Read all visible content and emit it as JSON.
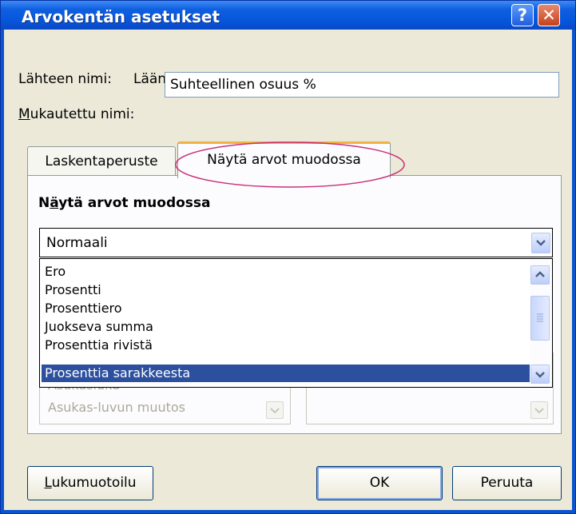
{
  "window": {
    "title": "Arvokentän asetukset",
    "help_label": "?",
    "close_label": "✕"
  },
  "source": {
    "label": "Lähteen nimi:",
    "value": "Lääni"
  },
  "custom_name": {
    "label_first": "M",
    "label_rest": "ukautettu nimi:",
    "value": "Suhteellinen osuus %"
  },
  "tabs": [
    {
      "label": "Laskentaperuste",
      "selected": false
    },
    {
      "label": "Näytä arvot muodossa",
      "selected": true
    }
  ],
  "section": {
    "heading_pre": "N",
    "heading_ul": "ä",
    "heading_post": "ytä arvot muodossa"
  },
  "dropdown": {
    "selected": "Normaali",
    "options": [
      "Ero",
      "Prosentti",
      "Prosenttiero",
      "Juokseva summa",
      "Prosenttia rivistä",
      "Prosenttia sarakkeesta"
    ],
    "highlighted_option": "Prosenttia sarakkeesta"
  },
  "base_fields": {
    "visible_items": [
      "Asukasluku",
      "Asukas-luvun muutos"
    ]
  },
  "buttons": {
    "format_first": "L",
    "format_rest": "ukumuotoilu",
    "ok": "OK",
    "cancel": "Peruuta"
  },
  "colors": {
    "titlebar": "#0a54cf",
    "selection": "#2c4f9e",
    "highlight_ellipse": "#c8307a",
    "tab_accent": "#f0b240"
  }
}
